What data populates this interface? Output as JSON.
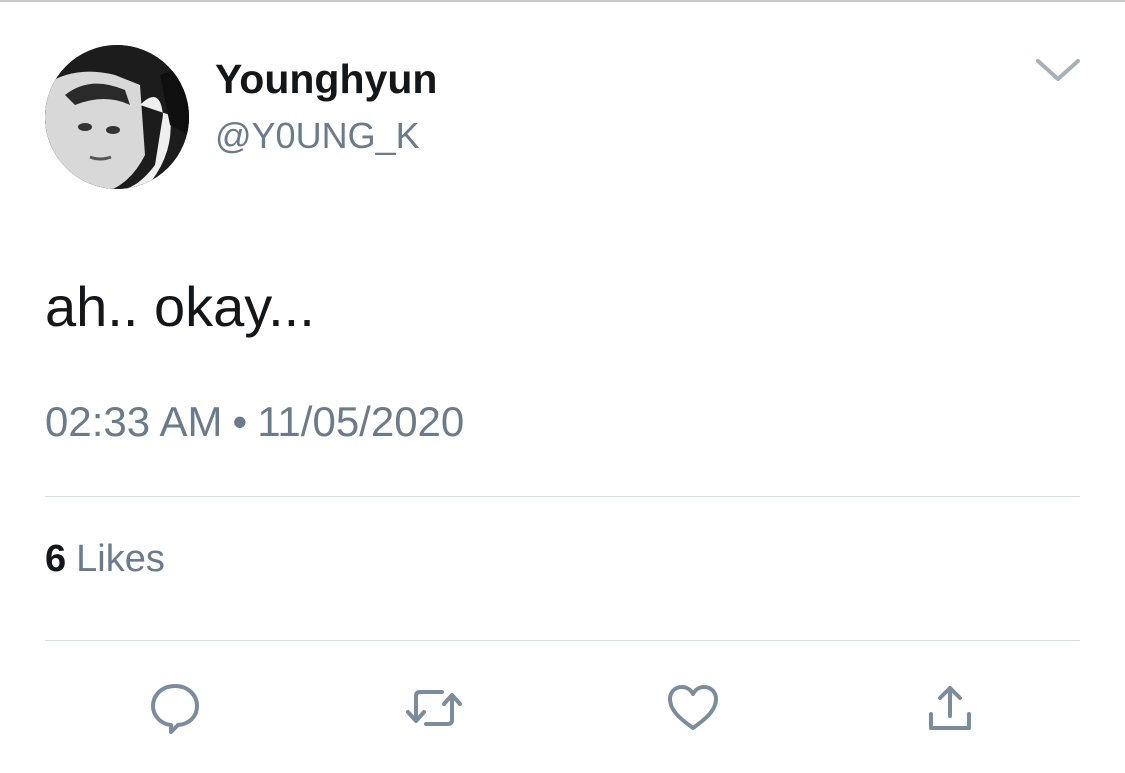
{
  "author": {
    "display_name": "Younghyun",
    "handle": "@Y0UNG_K"
  },
  "tweet": {
    "text": "ah.. okay...",
    "time": "02:33 AM",
    "separator": "•",
    "date": "11/05/2020"
  },
  "stats": {
    "likes_count": "6",
    "likes_label": "Likes"
  },
  "icons": {
    "more": "chevron-down-icon",
    "reply": "reply-icon",
    "retweet": "retweet-icon",
    "like": "heart-icon",
    "share": "share-icon"
  },
  "colors": {
    "text_primary": "#14171a",
    "text_secondary": "#6b7b8a",
    "divider": "#d6dce1",
    "icon": "#7b8d9c"
  }
}
